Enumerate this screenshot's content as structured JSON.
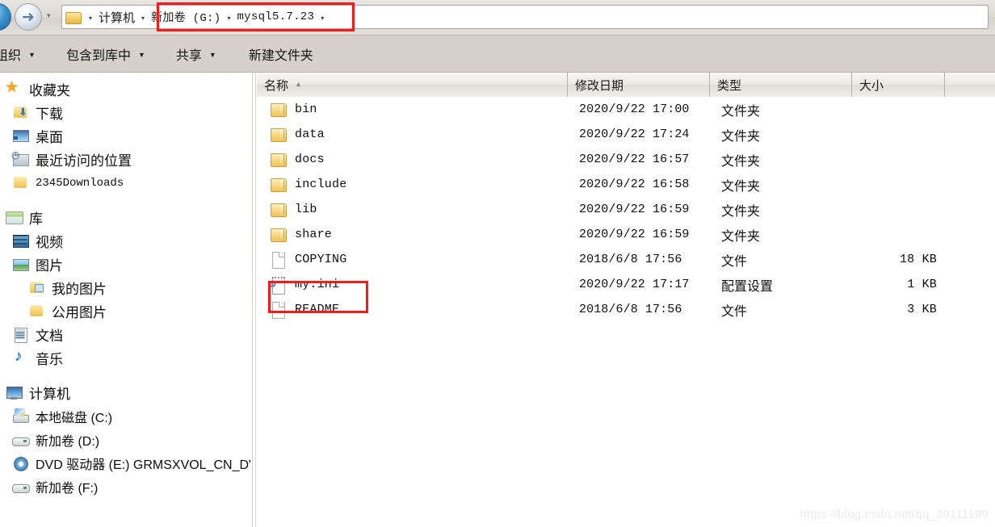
{
  "window": {
    "title": "mysql5.7.23"
  },
  "navigation": {
    "back_icon": "back-arrow-icon",
    "forward_icon": "forward-arrow-icon",
    "forward_glyph": "➜",
    "recent_pages_glyph": "▾"
  },
  "address_bar": {
    "folder_icon": "folder-icon",
    "separator": "▾",
    "segments": [
      {
        "label": "计算机",
        "mono": false
      },
      {
        "label": "新加卷 (G:)",
        "mono": true
      },
      {
        "label": "mysql5.7.23",
        "mono": true
      }
    ],
    "highlight_color": "#f51b1b"
  },
  "toolbar": {
    "organize_label": "组织",
    "include_label": "包含到库中",
    "share_label": "共享",
    "new_folder_label": "新建文件夹",
    "caret": "▼"
  },
  "sidebar": {
    "groups": [
      {
        "header": {
          "label": "收藏夹",
          "icon": "star-icon"
        },
        "items": [
          {
            "label": "下载",
            "icon": "folder-download-icon",
            "style": "cn"
          },
          {
            "label": "桌面",
            "icon": "desktop-icon",
            "style": "cn"
          },
          {
            "label": "最近访问的位置",
            "icon": "recent-places-icon",
            "style": "cn"
          },
          {
            "label": "2345Downloads",
            "icon": "folder-icon",
            "style": "mono"
          }
        ]
      },
      {
        "header": {
          "label": "库",
          "icon": "library-icon"
        },
        "items": [
          {
            "label": "视频",
            "icon": "video-icon",
            "style": "cn",
            "indent": 1
          },
          {
            "label": "图片",
            "icon": "picture-icon",
            "style": "cn",
            "indent": 1
          },
          {
            "label": "我的图片",
            "icon": "folder-picture-icon",
            "style": "cn",
            "indent": 2
          },
          {
            "label": "公用图片",
            "icon": "folder-icon",
            "style": "cn",
            "indent": 2
          },
          {
            "label": "文档",
            "icon": "document-icon",
            "style": "cn",
            "indent": 1
          },
          {
            "label": "音乐",
            "icon": "music-icon",
            "style": "cn",
            "indent": 1
          }
        ]
      },
      {
        "header": {
          "label": "计算机",
          "icon": "computer-icon"
        },
        "items": [
          {
            "label": "本地磁盘 (C:)",
            "icon": "hdd-system-icon",
            "style": "mixed"
          },
          {
            "label": "新加卷 (D:)",
            "icon": "drive-icon",
            "style": "mixed"
          },
          {
            "label": "DVD 驱动器 (E:) GRMSXVOL_CN_DVD",
            "icon": "dvd-drive-icon",
            "style": "mixed"
          },
          {
            "label": "新加卷 (F:)",
            "icon": "drive-icon",
            "style": "mixed"
          }
        ]
      }
    ]
  },
  "file_list": {
    "columns": [
      {
        "key": "name",
        "label": "名称",
        "sorted": true,
        "sort_arrow": "▲"
      },
      {
        "key": "date",
        "label": "修改日期"
      },
      {
        "key": "type",
        "label": "类型"
      },
      {
        "key": "size",
        "label": "大小"
      }
    ],
    "rows": [
      {
        "name": "bin",
        "date": "2020/9/22 17:00",
        "type": "文件夹",
        "size": "",
        "icon": "folder-icon"
      },
      {
        "name": "data",
        "date": "2020/9/22 17:24",
        "type": "文件夹",
        "size": "",
        "icon": "folder-icon"
      },
      {
        "name": "docs",
        "date": "2020/9/22 16:57",
        "type": "文件夹",
        "size": "",
        "icon": "folder-icon"
      },
      {
        "name": "include",
        "date": "2020/9/22 16:58",
        "type": "文件夹",
        "size": "",
        "icon": "folder-icon"
      },
      {
        "name": "lib",
        "date": "2020/9/22 16:59",
        "type": "文件夹",
        "size": "",
        "icon": "folder-icon"
      },
      {
        "name": "share",
        "date": "2020/9/22 16:59",
        "type": "文件夹",
        "size": "",
        "icon": "folder-icon"
      },
      {
        "name": "COPYING",
        "date": "2018/6/8 17:56",
        "type": "文件",
        "size": "18 KB",
        "icon": "file-icon"
      },
      {
        "name": "my.ini",
        "date": "2020/9/22 17:17",
        "type": "配置设置",
        "size": "1 KB",
        "icon": "ini-config-icon",
        "highlighted": true
      },
      {
        "name": "README",
        "date": "2018/6/8 17:56",
        "type": "文件",
        "size": "3 KB",
        "icon": "file-icon"
      }
    ]
  },
  "watermark": {
    "text": "https://blog.csdn.net/qq_39111199"
  }
}
